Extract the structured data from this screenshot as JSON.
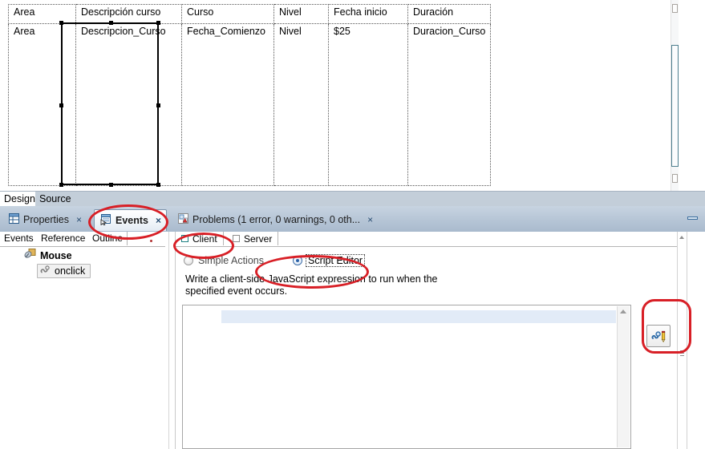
{
  "design": {
    "table": {
      "headers": [
        "Area",
        "Descripción curso",
        "Curso",
        "Nivel",
        "Fecha inicio",
        "Duración"
      ],
      "values": [
        "Area",
        "Descripcion_Curso",
        "Fecha_Comienzo",
        "Nivel",
        "$25",
        "Duracion_Curso"
      ]
    },
    "editor_tabs": [
      {
        "label": "Design",
        "active": true
      },
      {
        "label": "Source",
        "active": false
      }
    ]
  },
  "view_tabs": [
    {
      "label": "Properties",
      "icon": "properties-grid-icon",
      "close": "×",
      "active": false
    },
    {
      "label": "Events",
      "icon": "events-icon",
      "close": "×",
      "active": true
    },
    {
      "label": "Problems (1 error, 0 warnings, 0 oth...",
      "icon": "problems-icon",
      "close": "×",
      "active": false
    }
  ],
  "minimize_tooltip": "Minimize",
  "left_pane": {
    "tabs": [
      {
        "label": "Events",
        "active": true
      },
      {
        "label": "Reference",
        "active": false
      },
      {
        "label": "Outline",
        "active": false
      }
    ],
    "tree": [
      {
        "label": "Mouse",
        "level": 1,
        "icon": "mouse-icon"
      },
      {
        "label": "onclick",
        "level": 2,
        "icon": "event-handler-icon",
        "selected": true
      }
    ]
  },
  "right_pane": {
    "tabs": [
      {
        "label": "Client",
        "icon": "client-square-icon",
        "active": true
      },
      {
        "label": "Server",
        "icon": "server-square-icon",
        "active": false
      }
    ],
    "radios": [
      {
        "label": "Simple Actions",
        "checked": false,
        "focused": false
      },
      {
        "label": "Script Editor",
        "checked": true,
        "focused": true
      }
    ],
    "hint": "Write a client-side JavaScript expression to run when the specified event occurs.",
    "script_editor": {
      "value": "",
      "placeholder": ""
    },
    "script_button": {
      "name": "edit-script-button",
      "icon": "script-pencil-icon",
      "label": ""
    }
  },
  "colors": {
    "annotation_red": "#d81f26",
    "tab_bar_blue": "#b6c5d6",
    "editor_tab_bar": "#c3ced9",
    "current_line": "#e2ebf7",
    "radio_dot": "#2c62a8",
    "tree_icon_teal": "#1d7f82"
  },
  "annotations": [
    {
      "name": "highlight-events-tab",
      "shape": "ellipse"
    },
    {
      "name": "highlight-client-tab",
      "shape": "ellipse"
    },
    {
      "name": "highlight-script-editor-radio",
      "shape": "ellipse"
    },
    {
      "name": "highlight-script-button",
      "shape": "rounded-rect"
    }
  ]
}
